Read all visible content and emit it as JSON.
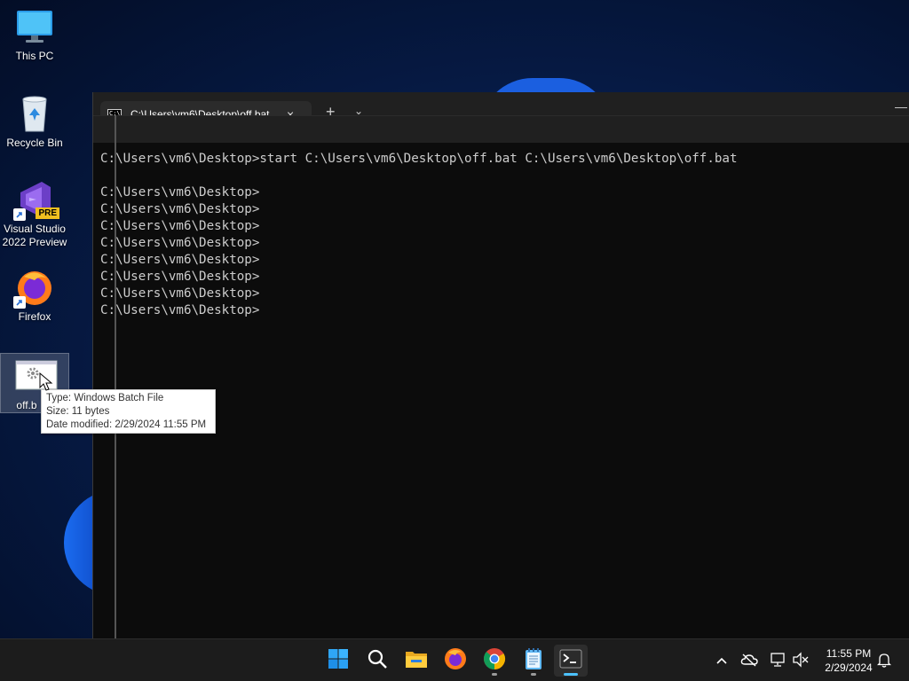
{
  "desktop": {
    "icons": [
      {
        "label": "This PC",
        "icon": "computer-icon"
      },
      {
        "label": "Recycle Bin",
        "icon": "recycle-bin-icon"
      },
      {
        "label": "Visual Studio 2022 Preview",
        "icon": "visual-studio-icon",
        "badge": "PRE"
      },
      {
        "label": "Firefox",
        "icon": "firefox-icon"
      },
      {
        "label": "off.bat",
        "display_label": "off.b",
        "icon": "batch-file-icon"
      }
    ]
  },
  "tooltip": {
    "type": "Type: Windows Batch File",
    "size": "Size: 11 bytes",
    "modified": "Date modified: 2/29/2024 11:55 PM"
  },
  "terminal": {
    "tab_title": "C:\\Users\\vm6\\Desktop\\off.bat",
    "tab_icon_text": "C:\\",
    "new_tab_label": "+",
    "dropdown_label": "⌄",
    "close_label": "×",
    "minimize_label": "—",
    "lines": [
      "C:\\Users\\vm6\\Desktop>start C:\\Users\\vm6\\Desktop\\off.bat C:\\Users\\vm6\\Desktop\\off.bat",
      "",
      "C:\\Users\\vm6\\Desktop>",
      "C:\\Users\\vm6\\Desktop>",
      "C:\\Users\\vm6\\Desktop>",
      "C:\\Users\\vm6\\Desktop>",
      "C:\\Users\\vm6\\Desktop>",
      "C:\\Users\\vm6\\Desktop>",
      "C:\\Users\\vm6\\Desktop>",
      "C:\\Users\\vm6\\Desktop>"
    ]
  },
  "taskbar": {
    "apps": [
      {
        "name": "start-button",
        "icon": "windows-logo-icon"
      },
      {
        "name": "search-button",
        "icon": "search-icon"
      },
      {
        "name": "file-explorer",
        "icon": "folder-icon"
      },
      {
        "name": "firefox",
        "icon": "firefox-icon"
      },
      {
        "name": "chrome",
        "icon": "chrome-icon"
      },
      {
        "name": "notepad",
        "icon": "notepad-icon"
      },
      {
        "name": "terminal",
        "icon": "terminal-icon",
        "active": true
      }
    ],
    "tray": {
      "overflow": "^",
      "time": "11:55 PM",
      "date": "2/29/2024"
    }
  },
  "colors": {
    "terminal_bg": "#0c0c0c",
    "terminal_text": "#cccccc",
    "taskbar_bg": "#1c1c1c",
    "accent": "#4cc2ff"
  }
}
